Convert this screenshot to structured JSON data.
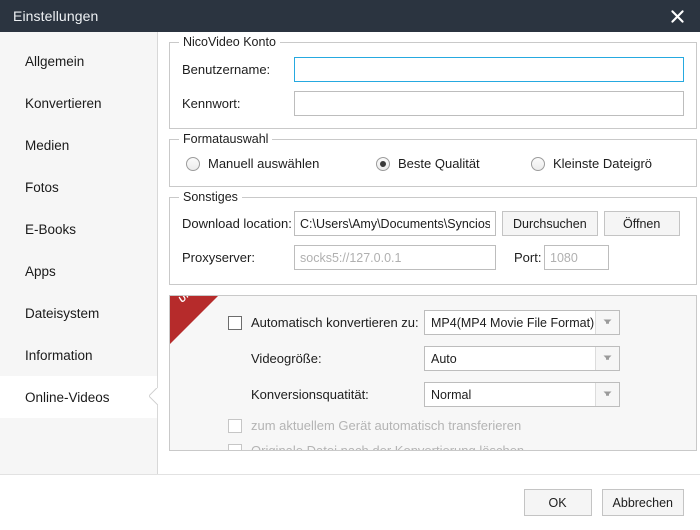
{
  "window": {
    "title": "Einstellungen",
    "close_icon": "close-icon"
  },
  "sidebar": {
    "items": [
      {
        "label": "Allgemein",
        "active": false
      },
      {
        "label": "Konvertieren",
        "active": false
      },
      {
        "label": "Medien",
        "active": false
      },
      {
        "label": "Fotos",
        "active": false
      },
      {
        "label": "E-Books",
        "active": false
      },
      {
        "label": "Apps",
        "active": false
      },
      {
        "label": "Dateisystem",
        "active": false
      },
      {
        "label": "Information",
        "active": false
      },
      {
        "label": "Online-Videos",
        "active": true
      }
    ]
  },
  "account": {
    "legend": "NicoVideo Konto",
    "username_label": "Benutzername:",
    "username_value": "",
    "username_placeholder": "",
    "password_label": "Kennwort:",
    "password_value": "",
    "password_placeholder": ""
  },
  "format": {
    "legend": "Formatauswahl",
    "options": [
      {
        "label": "Manuell auswählen",
        "selected": false
      },
      {
        "label": "Beste Qualität",
        "selected": true
      },
      {
        "label": "Kleinste Dateigrö",
        "selected": false
      }
    ]
  },
  "misc": {
    "legend": "Sonstiges",
    "download_label": "Download location:",
    "download_value": "C:\\Users\\Amy\\Documents\\Syncios'",
    "browse_button": "Durchsuchen",
    "open_button": "Öffnen",
    "proxy_label": "Proxyserver:",
    "proxy_value": "",
    "proxy_placeholder": "socks5://127.0.0.1",
    "port_label": "Port:",
    "port_value": "",
    "port_placeholder": "1080"
  },
  "ultimate": {
    "ribbon_label": "Ultimate",
    "auto_convert_label": "Automatisch konvertieren zu:",
    "auto_convert_checked": false,
    "format_value": "MP4(MP4 Movie File Format)",
    "videosize_label": "Videogröße:",
    "videosize_value": "Auto",
    "quality_label": "Konversionsquatität:",
    "quality_value": "Normal",
    "transfer_label": "zum aktuellem Gerät automatisch transferieren",
    "transfer_checked": false,
    "delete_label": "Originale Datei nach der Konvertierung löschen",
    "delete_checked": false
  },
  "footer": {
    "ok_label": "OK",
    "cancel_label": "Abbrechen"
  },
  "colors": {
    "titlebar": "#2b3440",
    "accent_focus": "#26a9e0",
    "ribbon_red": "#b62b2b"
  }
}
